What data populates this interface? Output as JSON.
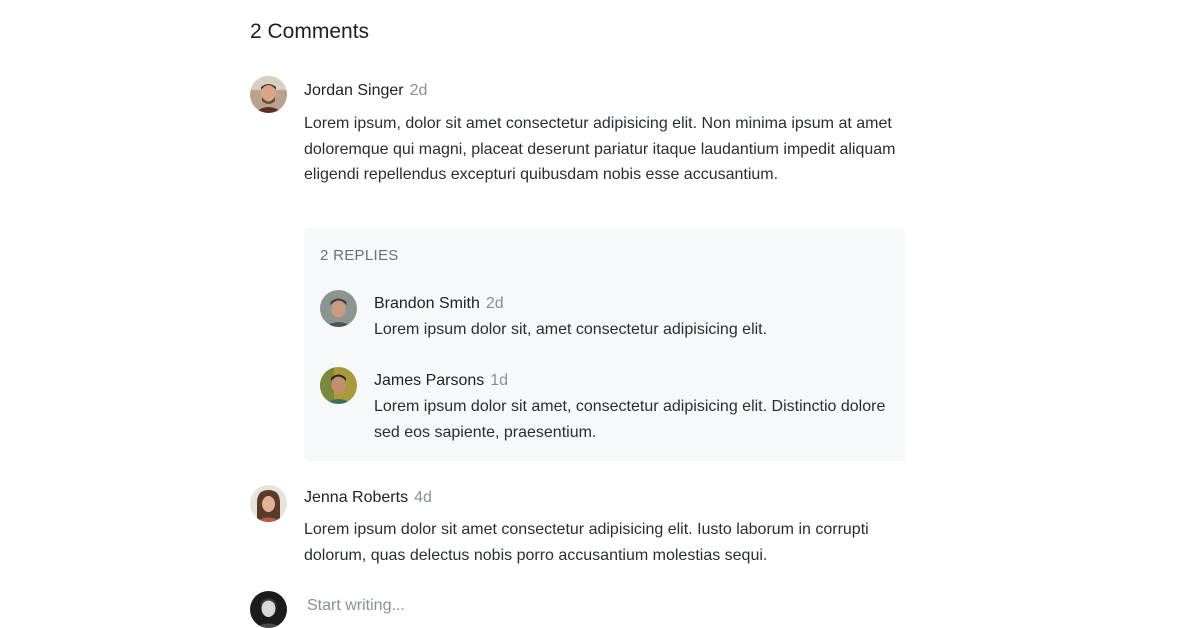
{
  "section": {
    "title": "2 Comments"
  },
  "comments": [
    {
      "author": "Jordan Singer",
      "time": "2d",
      "text": "Lorem ipsum, dolor sit amet consectetur adipisicing elit. Non minima ipsum at amet doloremque qui magni, placeat deserunt pariatur itaque laudantium impedit aliquam eligendi repellendus excepturi quibusdam nobis esse accusantium.",
      "avatar_icon": "user-photo-avatar",
      "replies_label": "2 REPLIES",
      "replies": [
        {
          "author": "Brandon Smith",
          "time": "2d",
          "text": "Lorem ipsum dolor sit, amet consectetur adipisicing elit.",
          "avatar_icon": "user-photo-avatar"
        },
        {
          "author": "James Parsons",
          "time": "1d",
          "text": "Lorem ipsum dolor sit amet, consectetur adipisicing elit. Distinctio dolore sed eos sapiente, praesentium.",
          "avatar_icon": "user-photo-avatar"
        }
      ]
    },
    {
      "author": "Jenna Roberts",
      "time": "4d",
      "text": "Lorem ipsum dolor sit amet consectetur adipisicing elit. Iusto laborum in corrupti dolorum, quas delectus nobis porro accusantium molestias sequi.",
      "avatar_icon": "user-photo-avatar"
    }
  ],
  "composer": {
    "placeholder": "Start writing...",
    "value": "",
    "avatar_icon": "current-user-avatar"
  },
  "colors": {
    "reply_background": "#f7f8fa",
    "muted_text": "#8a8f96",
    "primary_text": "#222222"
  }
}
